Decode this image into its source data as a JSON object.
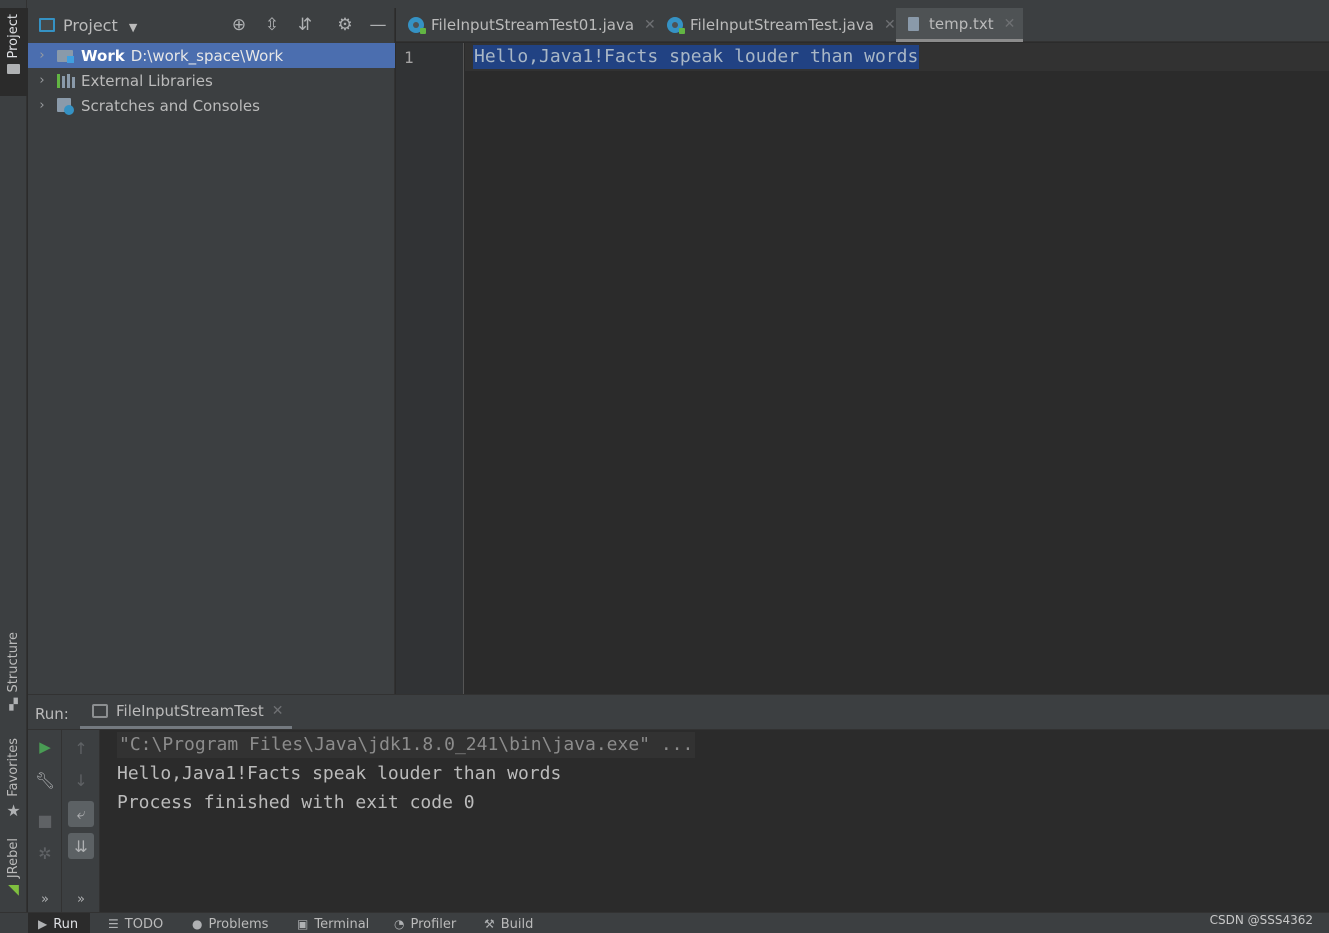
{
  "left_strip": {
    "project_label": "Project",
    "structure_label": "Structure",
    "favorites_label": "Favorites",
    "jrebel_label": "JRebel"
  },
  "project_panel": {
    "title": "Project",
    "tree": [
      {
        "label": "Work",
        "path": "D:\\work_space\\Work",
        "selected": true,
        "icon": "module-folder-icon"
      },
      {
        "label": "External Libraries",
        "icon": "libraries-icon"
      },
      {
        "label": "Scratches and Consoles",
        "icon": "scratches-icon"
      }
    ]
  },
  "editor": {
    "tabs": [
      {
        "label": "FileInputStreamTest01.java",
        "icon": "java-class-icon",
        "active": false
      },
      {
        "label": "FileInputStreamTest.java",
        "icon": "java-class-icon",
        "active": false
      },
      {
        "label": "temp.txt",
        "icon": "text-file-icon",
        "active": true
      }
    ],
    "line_number": "1",
    "line_text": "Hello,Java1!Facts speak louder than words"
  },
  "run_panel": {
    "label": "Run:",
    "tab_label": "FileInputStreamTest",
    "console_lines": [
      "\"C:\\Program Files\\Java\\jdk1.8.0_241\\bin\\java.exe\" ...",
      "Hello,Java1!Facts speak louder than words",
      "Process finished with exit code 0"
    ]
  },
  "bottom_bar": {
    "tabs": [
      "Run",
      "TODO",
      "Problems",
      "Terminal",
      "Profiler",
      "Build"
    ],
    "watermark": "CSDN @SSS4362"
  },
  "colors": {
    "selection": "#4b6eaf",
    "text_selection": "#214283",
    "run_green": "#499c54"
  }
}
